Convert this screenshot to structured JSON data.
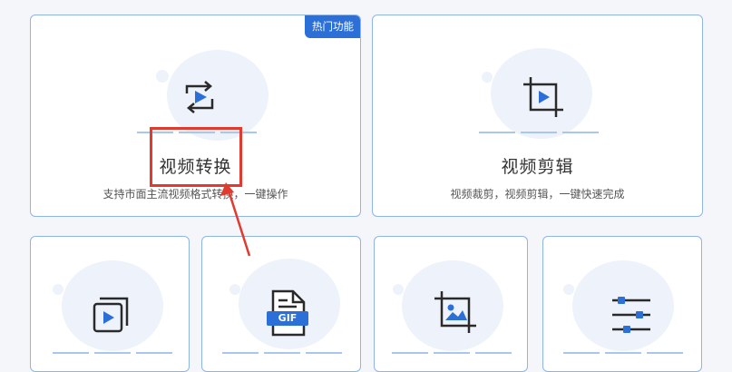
{
  "badge": {
    "text": "热门功能"
  },
  "cards": [
    {
      "title": "视频转换",
      "desc": "支持市面主流视频格式转换，一键操作",
      "icon": "convert-icon"
    },
    {
      "title": "视频剪辑",
      "desc": "视频裁剪，视频剪辑，一键快速完成",
      "icon": "crop-icon"
    },
    {
      "icon": "playlist-icon"
    },
    {
      "icon": "gif-file-icon",
      "gif_label": "GIF"
    },
    {
      "icon": "image-crop-icon"
    },
    {
      "icon": "sliders-icon"
    }
  ],
  "colors": {
    "accent": "#2c6fd6",
    "icon_stroke": "#2a2a2a",
    "card_border": "#8fb4e6",
    "annotation": "#e03b2e"
  }
}
